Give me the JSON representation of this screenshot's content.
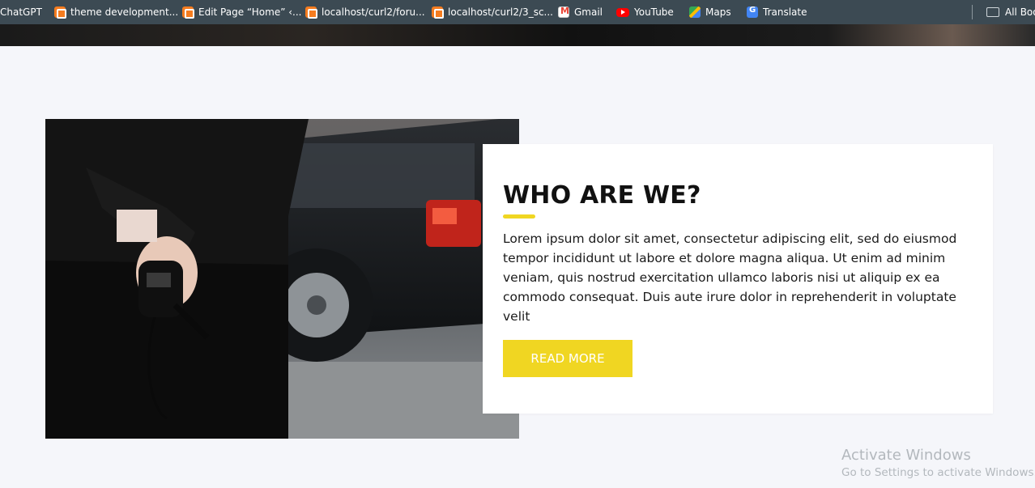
{
  "bookmarks": [
    {
      "label": "ChatGPT",
      "icon": "none"
    },
    {
      "label": "theme development...",
      "icon": "xampp-icon"
    },
    {
      "label": "Edit Page “Home” ‹...",
      "icon": "xampp-icon"
    },
    {
      "label": "localhost/curl2/foru...",
      "icon": "xampp-icon"
    },
    {
      "label": "localhost/curl2/3_sc...",
      "icon": "xampp-icon"
    },
    {
      "label": "Gmail",
      "icon": "gmail-icon"
    },
    {
      "label": "YouTube",
      "icon": "youtube-icon"
    },
    {
      "label": "Maps",
      "icon": "maps-icon"
    },
    {
      "label": "Translate",
      "icon": "translate-icon"
    }
  ],
  "bookmarks_folder": {
    "label": "All Boo",
    "icon": "folder-icon"
  },
  "section": {
    "title": "WHO ARE WE?",
    "body": "Lorem ipsum dolor sit amet, consectetur adipiscing elit, sed do eiusmod tempor incididunt ut labore et dolore magna aliqua. Ut enim ad minim veniam, quis nostrud exercitation ullamco laboris nisi ut aliquip ex ea commodo consequat. Duis aute irure dolor in reprehenderit in voluptate velit",
    "button_label": "READ MORE",
    "accent_color": "#f0d622"
  },
  "watermark": {
    "line1": "Activate Windows",
    "line2": "Go to Settings to activate Windows."
  }
}
